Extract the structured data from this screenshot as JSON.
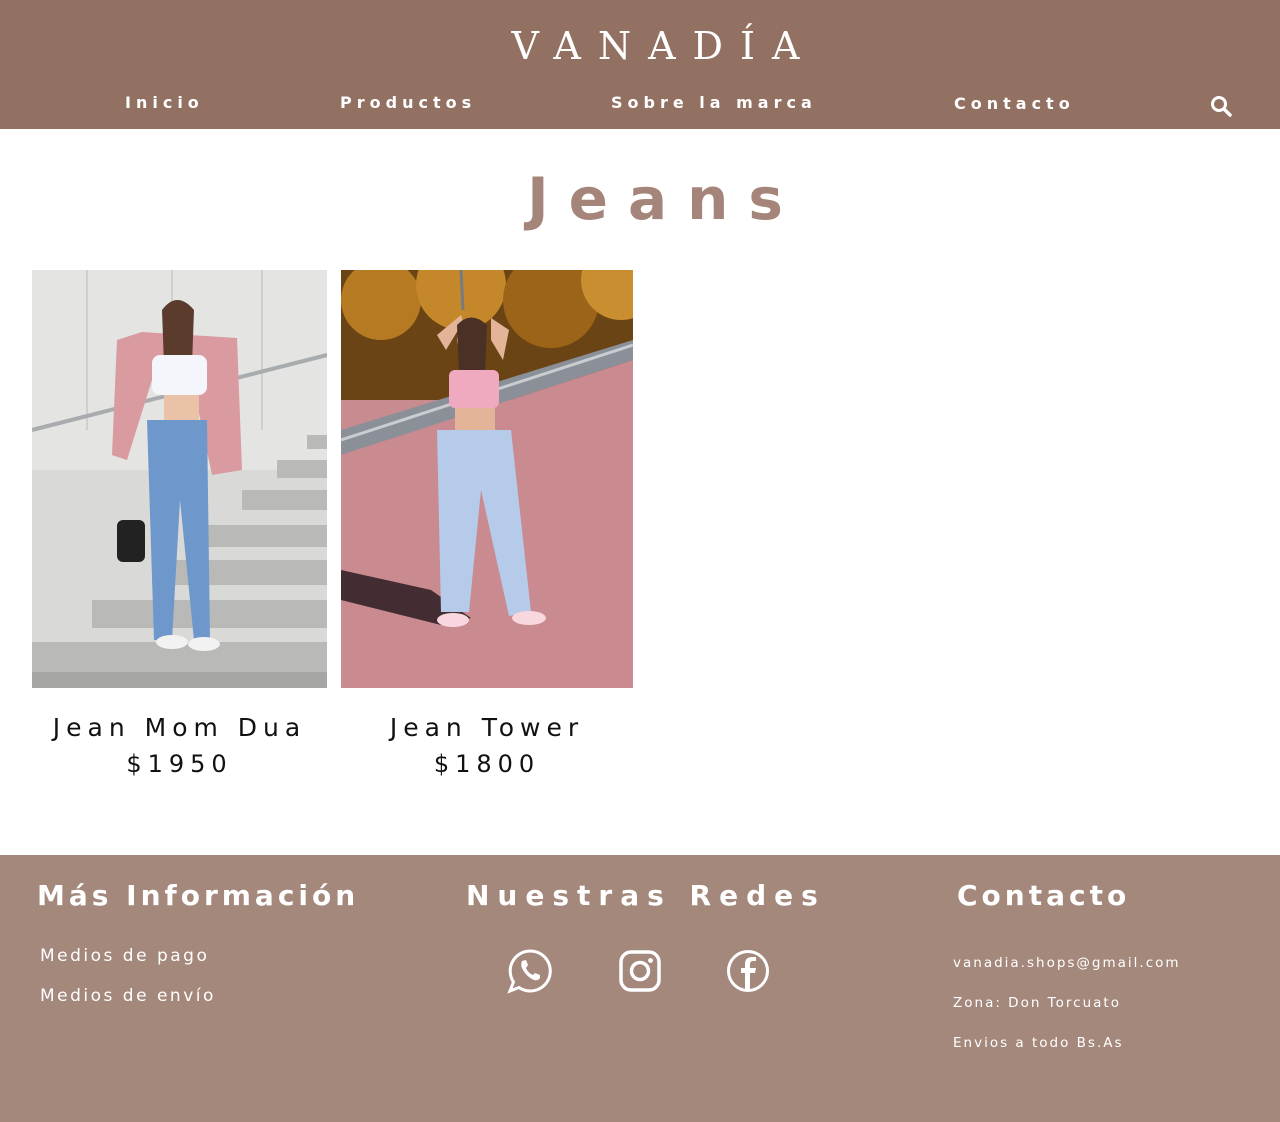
{
  "brand": {
    "logo": "VANADÍA"
  },
  "nav": {
    "items": [
      {
        "label": "Inicio"
      },
      {
        "label": "Productos"
      },
      {
        "label": "Sobre la marca"
      },
      {
        "label": "Contacto"
      }
    ],
    "search_icon": "search-icon"
  },
  "page": {
    "title": "Jeans"
  },
  "products": [
    {
      "name": "Jean Mom Dua",
      "price": "$1950"
    },
    {
      "name": "Jean Tower",
      "price": "$1800"
    }
  ],
  "footer": {
    "info": {
      "heading": "Más Información",
      "links": [
        "Medios de pago",
        "Medios de envío"
      ]
    },
    "social": {
      "heading": "Nuestras Redes",
      "icons": [
        "whatsapp-icon",
        "instagram-icon",
        "facebook-icon"
      ]
    },
    "contact": {
      "heading": "Contacto",
      "lines": [
        "vanadia.shops@gmail.com",
        "Zona: Don Torcuato",
        "Envios a todo Bs.As"
      ]
    }
  },
  "colors": {
    "header_bg": "#927062",
    "footer_bg": "#a5887c",
    "title": "#a5857a"
  }
}
